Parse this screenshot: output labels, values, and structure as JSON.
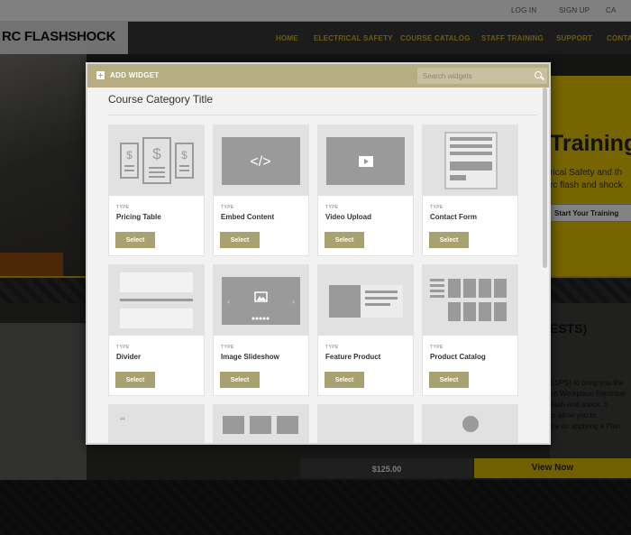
{
  "site": {
    "brand": "RC FLASHSHOCK",
    "utility": {
      "login": "LOG IN",
      "signup": "SIGN UP",
      "cart": "CA"
    },
    "nav": [
      "HOME",
      "ELECTRICAL SAFETY",
      "COURSE CATALOG",
      "STAFF TRAINING",
      "SUPPORT",
      "CONTA"
    ],
    "hero": {
      "title": "Training",
      "line1": "rical Safety and th",
      "line2": "rc flash and shock",
      "button": "Start Your Training"
    },
    "section": {
      "heading": "ESTS)",
      "lines": [
        "ESPS) to bring you the",
        "on Workplace Electrical",
        "flash and shock. It",
        "to allow you to",
        "ice on applying a Plan,"
      ]
    },
    "price": "$125.00",
    "view_now": "View Now"
  },
  "modal": {
    "title": "ADD WIDGET",
    "search_placeholder": "Search widgets",
    "category_title": "Course Category Title",
    "type_label": "TYPE",
    "select_label": "Select",
    "widgets": [
      {
        "name": "Pricing Table",
        "icon": "pricing-table-icon"
      },
      {
        "name": "Embed Content",
        "icon": "code-icon"
      },
      {
        "name": "Video Upload",
        "icon": "video-play-icon"
      },
      {
        "name": "Contact Form",
        "icon": "form-icon"
      },
      {
        "name": "Divider",
        "icon": "divider-icon"
      },
      {
        "name": "Image Slideshow",
        "icon": "slideshow-icon"
      },
      {
        "name": "Feature Product",
        "icon": "feature-product-icon"
      },
      {
        "name": "Product Catalog",
        "icon": "grid-icon"
      }
    ],
    "accent": "#b6ad83",
    "button_color": "#a9a16f"
  }
}
